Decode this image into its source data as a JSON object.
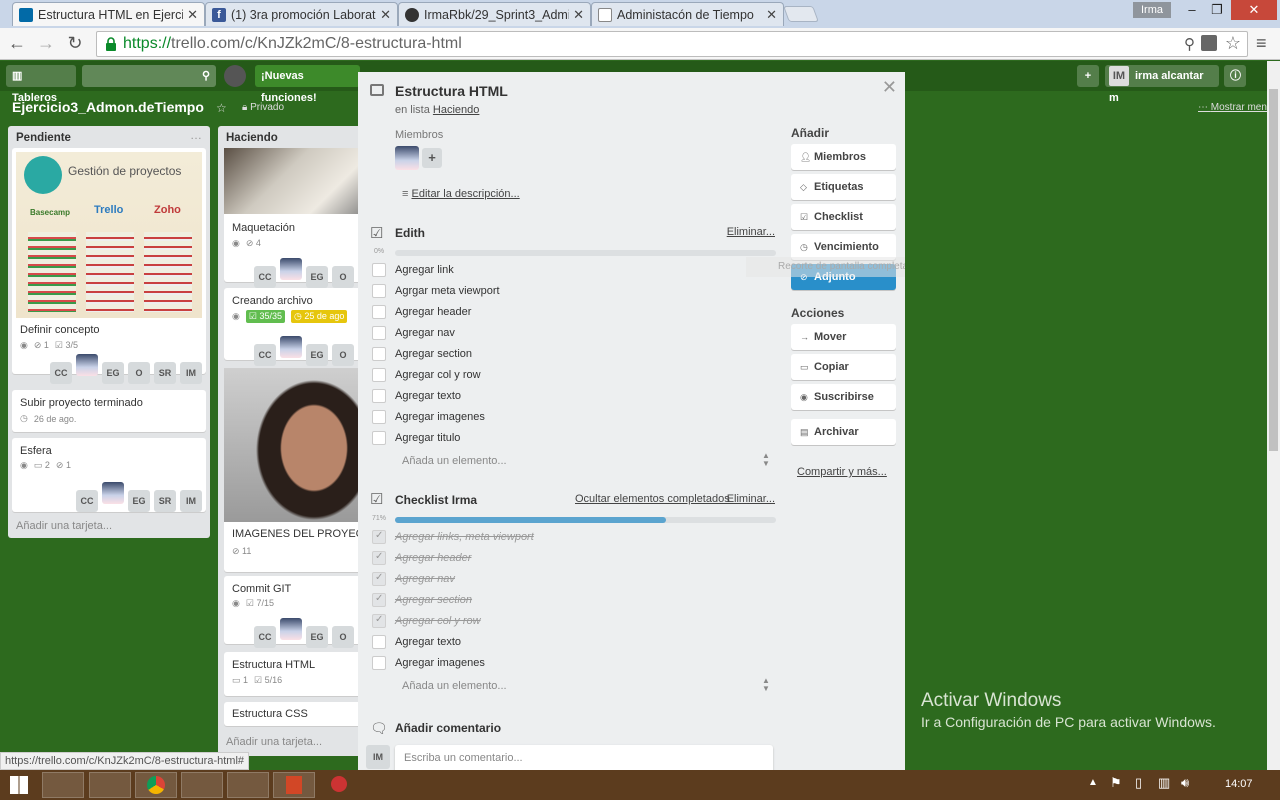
{
  "browser": {
    "tabs": [
      {
        "title": "Estructura HTML en Ejercic",
        "icon": "trello-icon",
        "color": "#026aa7"
      },
      {
        "title": "(1) 3ra promoción Laborat",
        "icon": "facebook-icon",
        "color": "#3b5998"
      },
      {
        "title": "IrmaRbk/29_Sprint3_Admi",
        "icon": "github-icon",
        "color": "#333333"
      },
      {
        "title": "Administacón de Tiempo",
        "icon": "document-icon",
        "color": "#888888"
      }
    ],
    "profile": "Irma",
    "url_scheme": "https://",
    "url_rest": "trello.com/c/KnJZk2mC/8-estructura-html"
  },
  "trello": {
    "boards_label": "Tableros",
    "new_features": "¡Nuevas funciones!",
    "user_initials": "IM",
    "user_name": "irma alcantar m",
    "board_name": "Ejercicio3_Admon.deTiempo",
    "privacy": "Privado",
    "show_menu": "Mostrar menú",
    "lists": [
      {
        "name": "Pendiente",
        "cover_title": "Gestión de proyectos",
        "cover_logos": [
          "Basecamp",
          "Trello",
          "Zoho"
        ],
        "cards": [
          {
            "title": "Definir concepto",
            "watch": "1",
            "checklist": "3/5",
            "members": [
              "CC",
              "",
              "EG",
              "O",
              "SR",
              "IM"
            ]
          },
          {
            "title": "Subir proyecto terminado",
            "due": "26 de ago."
          },
          {
            "title": "Esfera",
            "comments": "2",
            "attachments": "1",
            "members": [
              "CC",
              "",
              "EG",
              "SR",
              "IM"
            ]
          }
        ],
        "add_card": "Añadir una tarjeta..."
      },
      {
        "name": "Haciendo",
        "cards": [
          {
            "title": "Maquetación",
            "attachments": "4",
            "members": [
              "CC",
              "",
              "EG",
              "O"
            ]
          },
          {
            "title": "Creando archivo",
            "checklist": "35/35",
            "due": "25 de ago",
            "members": [
              "CC",
              "",
              "EG",
              "O"
            ]
          },
          {
            "title": "IMAGENES DEL PROYEC",
            "attachments": "11"
          },
          {
            "title": "Commit GIT",
            "checklist": "7/15",
            "members": [
              "CC",
              "",
              "EG",
              "O"
            ]
          },
          {
            "title": "Estructura HTML",
            "comments": "1",
            "checklist": "5/16"
          },
          {
            "title": "Estructura CSS"
          }
        ],
        "add_card": "Añadir una tarjeta..."
      }
    ]
  },
  "modal": {
    "title": "Estructura HTML",
    "in_list_prefix": "en lista",
    "in_list": "Haciendo",
    "members_label": "Miembros",
    "edit_description": "Editar la descripción...",
    "checklists": [
      {
        "title": "Edith",
        "delete": "Eliminar...",
        "percent_label": "0%",
        "progress": 0,
        "items": [
          {
            "text": "Agregar link",
            "done": false
          },
          {
            "text": "Agrgar meta viewport",
            "done": false
          },
          {
            "text": "Agregar header",
            "done": false
          },
          {
            "text": "Agregar nav",
            "done": false
          },
          {
            "text": "Agregar section",
            "done": false
          },
          {
            "text": "Agregar col y row",
            "done": false
          },
          {
            "text": "Agregar texto",
            "done": false
          },
          {
            "text": "Agregar imagenes",
            "done": false
          },
          {
            "text": "Agregar titulo",
            "done": false
          }
        ],
        "add_item": "Añada un elemento..."
      },
      {
        "title": "Checklist Irma",
        "hide_completed": "Ocultar elementos completados",
        "delete": "Eliminar...",
        "percent_label": "71%",
        "progress": 71,
        "items": [
          {
            "text": "Agregar links, meta viewport",
            "done": true
          },
          {
            "text": "Agregar header",
            "done": true
          },
          {
            "text": "Agregar nav",
            "done": true
          },
          {
            "text": "Agregar section",
            "done": true
          },
          {
            "text": "Agregar col y row",
            "done": true
          },
          {
            "text": "Agregar texto",
            "done": false
          },
          {
            "text": "Agregar imagenes",
            "done": false
          }
        ],
        "add_item": "Añada un elemento..."
      }
    ],
    "add_comment": "Añadir comentario",
    "comment_initials": "IM",
    "comment_placeholder": "Escriba un comentario...",
    "sidebar": {
      "add_title": "Añadir",
      "add_buttons": [
        "Miembros",
        "Etiquetas",
        "Checklist",
        "Vencimiento",
        "Adjunto"
      ],
      "actions_title": "Acciones",
      "action_buttons": [
        "Mover",
        "Copiar",
        "Suscribirse"
      ],
      "archive": "Archivar",
      "share": "Compartir y más...",
      "tooltip": "Recorte de pantalla completa"
    }
  },
  "overlay": {
    "activate_title": "Activar Windows",
    "activate_sub": "Ir a Configuración de PC para activar Windows."
  },
  "status_url": "https://trello.com/c/KnJZk2mC/8-estructura-html#",
  "taskbar": {
    "time": "14:07"
  }
}
